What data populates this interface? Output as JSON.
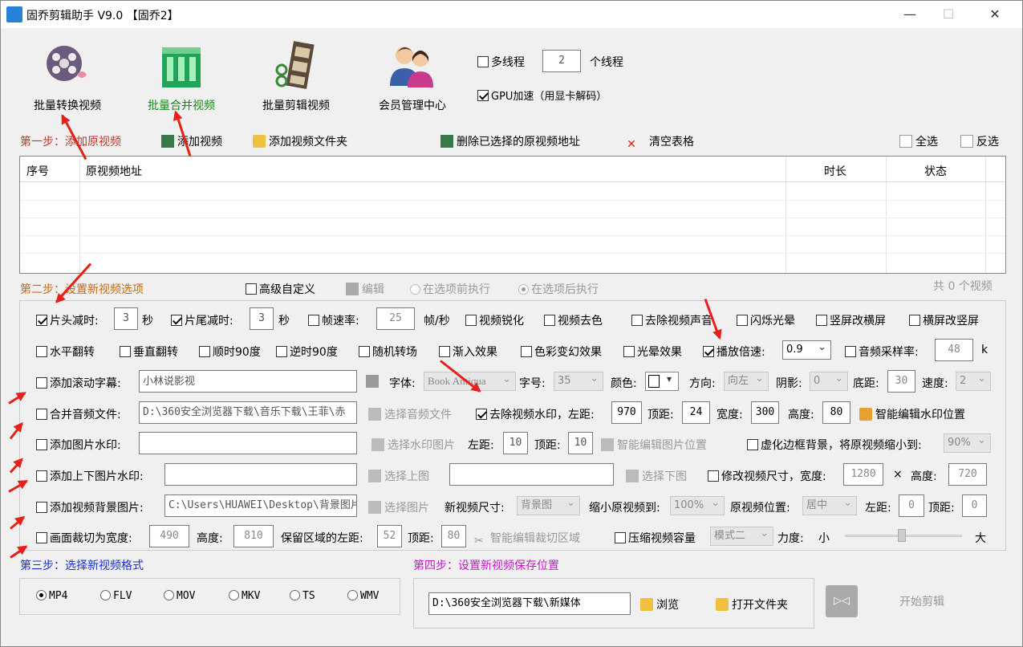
{
  "window": {
    "title": "固乔剪辑助手 V9.0 【固乔2】",
    "minimize": "—",
    "maximize": "☐",
    "close": "✕"
  },
  "toolbar": {
    "batch_convert": "批量转换视频",
    "batch_merge": "批量合并视频",
    "batch_edit": "批量剪辑视频",
    "member_center": "会员管理中心"
  },
  "thread": {
    "multithread_label": "多线程",
    "thread_count": "2",
    "thread_unit": "个线程",
    "gpu_label": "GPU加速（用显卡解码）"
  },
  "step1": {
    "label": "第一步：添加原视频",
    "add_video": "添加视频",
    "add_folder": "添加视频文件夹",
    "delete_selected": "删除已选择的原视频地址",
    "clear_table": "清空表格",
    "select_all": "全选",
    "invert_select": "反选"
  },
  "table": {
    "columns": [
      "序号",
      "原视频地址",
      "时长",
      "状态"
    ]
  },
  "step2": {
    "label": "第二步：设置新视频选项",
    "advanced": "高级自定义",
    "edit": "编辑",
    "exec_before": "在选项前执行",
    "exec_after": "在选项后执行",
    "count_text": "共 0 个视频"
  },
  "opts": {
    "head_trim": "片头减时:",
    "head_val": "3",
    "sec": "秒",
    "tail_trim": "片尾减时:",
    "tail_val": "3",
    "frame_rate": "帧速率:",
    "frame_val": "25",
    "fps_unit": "帧/秒",
    "sharpen": "视频锐化",
    "desaturate": "视频去色",
    "remove_audio": "去除视频声音",
    "flash": "闪烁光晕",
    "v2h": "竖屏改横屏",
    "h2v": "横屏改竖屏",
    "hflip": "水平翻转",
    "vflip": "垂直翻转",
    "rot90cw": "顺时90度",
    "rot90ccw": "逆时90度",
    "random_trans": "随机转场",
    "fade_in": "渐入效果",
    "color_fx": "色彩变幻效果",
    "halo": "光晕效果",
    "speed": "播放倍速:",
    "speed_val": "0.9",
    "sample_rate": "音频采样率:",
    "sample_val": "48",
    "sample_unit": "k",
    "scroll_sub": "添加滚动字幕:",
    "scroll_text": "小林说影视",
    "font_label": "字体:",
    "font_val": "Book Antiqua",
    "size_label": "字号:",
    "size_val": "35",
    "color_label": "颜色:",
    "dir_label": "方向:",
    "dir_val": "向左",
    "shadow_label": "阴影:",
    "shadow_val": "0",
    "bottom_label": "底距:",
    "bottom_val": "30",
    "speed2_label": "速度:",
    "speed2_val": "2",
    "merge_audio": "合并音频文件:",
    "audio_path": "D:\\360安全浏览器下载\\音乐下载\\王菲\\赤",
    "select_audio": "选择音频文件",
    "remove_wm": "去除视频水印，左距:",
    "wm_left": "970",
    "top_label": "顶距:",
    "wm_top": "24",
    "width_label": "宽度:",
    "wm_w": "300",
    "height_label": "高度:",
    "wm_h": "80",
    "smart_wm": "智能编辑水印位置",
    "img_wm": "添加图片水印:",
    "select_wm_img": "选择水印图片",
    "left_label": "左距:",
    "img_left": "10",
    "img_top": "10",
    "smart_img": "智能编辑图片位置",
    "blur_bg": "虚化边框背景，将原视频缩小到:",
    "blur_val": "90%",
    "tb_wm": "添加上下图片水印:",
    "select_top": "选择上图",
    "select_bottom": "选择下图",
    "resize": "修改视频尺寸，宽度:",
    "resize_w": "1280",
    "times": "×",
    "height2": "高度:",
    "resize_h": "720",
    "bg_img": "添加视频背景图片:",
    "bg_path": "C:\\Users\\HUAWEI\\Desktop\\背景图片",
    "select_img": "选择图片",
    "new_size": "新视频尺寸:",
    "new_size_val": "背景图",
    "shrink": "缩小原视频到:",
    "shrink_val": "100%",
    "orig_pos": "原视频位置:",
    "orig_pos_val": "居中",
    "pos_left": "0",
    "pos_top": "0",
    "crop": "画面裁切为宽度:",
    "crop_w": "490",
    "crop_h_label": "高度:",
    "crop_h": "810",
    "keep_left": "保留区域的左距:",
    "keep_left_val": "52",
    "keep_top": "80",
    "smart_crop": "智能编辑裁切区域",
    "compress": "压缩视频容量",
    "compress_mode": "模式二",
    "strength": "力度:",
    "small": "小",
    "large": "大"
  },
  "step3": {
    "label": "第三步：选择新视频格式",
    "formats": [
      "MP4",
      "FLV",
      "MOV",
      "MKV",
      "TS",
      "WMV"
    ]
  },
  "step4": {
    "label": "第四步：设置新视频保存位置",
    "path": "D:\\360安全浏览器下载\\新媒体",
    "browse": "浏览",
    "open_folder": "打开文件夹",
    "start": "开始剪辑"
  },
  "colors": {
    "step_red": "#c0392b",
    "step_blue": "#1a2fd0",
    "step_magenta": "#c818c8",
    "active_green": "#168a16",
    "arrow": "#e8201a"
  }
}
